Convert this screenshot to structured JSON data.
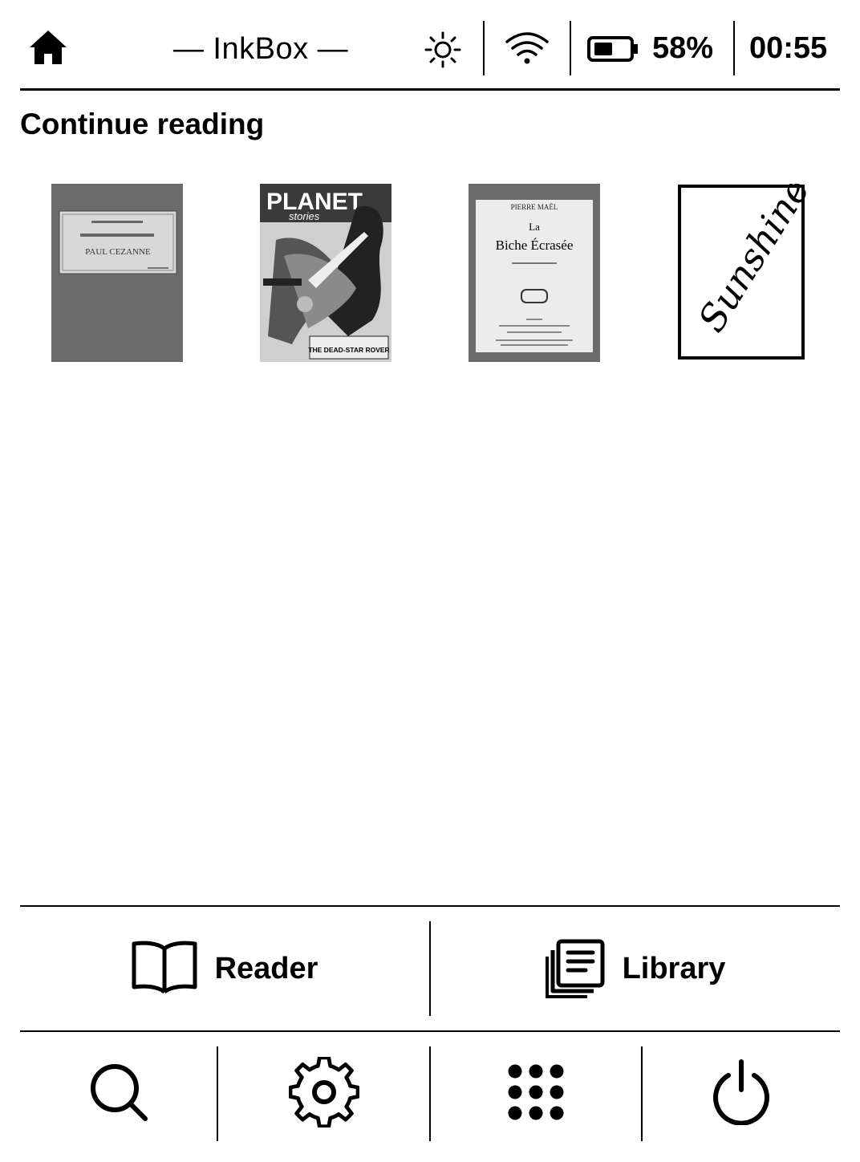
{
  "status_bar": {
    "app_title": "— InkBox —",
    "battery_percent": "58%",
    "time": "00:55",
    "icons": {
      "home": "home-icon",
      "brightness": "sun-icon",
      "wifi": "wifi-icon",
      "battery": "battery-icon"
    }
  },
  "continue_reading": {
    "title": "Continue reading",
    "books": [
      {
        "cover_text": [
          "PAUL CEZANNE"
        ]
      },
      {
        "cover_text": [
          "PLANET",
          "stories",
          "THE DEAD-STAR ROVER"
        ]
      },
      {
        "cover_text": [
          "PIERRE MAËL",
          "La",
          "Biche Écrasée"
        ]
      },
      {
        "cover_text": [
          "Sunshine"
        ]
      }
    ]
  },
  "nav": {
    "reader_label": "Reader",
    "library_label": "Library",
    "tools": [
      "search-icon",
      "settings-icon",
      "apps-icon",
      "power-icon"
    ]
  },
  "colors": {
    "foreground": "#000000",
    "background": "#ffffff",
    "cover_gray": "#6b6b6b"
  }
}
